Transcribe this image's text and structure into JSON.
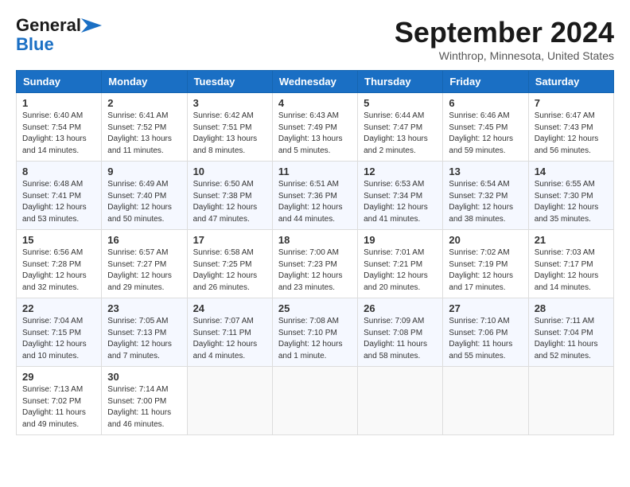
{
  "header": {
    "logo_line1": "General",
    "logo_line2": "Blue",
    "month": "September 2024",
    "location": "Winthrop, Minnesota, United States"
  },
  "days_of_week": [
    "Sunday",
    "Monday",
    "Tuesday",
    "Wednesday",
    "Thursday",
    "Friday",
    "Saturday"
  ],
  "weeks": [
    [
      {
        "day": "1",
        "info": "Sunrise: 6:40 AM\nSunset: 7:54 PM\nDaylight: 13 hours\nand 14 minutes."
      },
      {
        "day": "2",
        "info": "Sunrise: 6:41 AM\nSunset: 7:52 PM\nDaylight: 13 hours\nand 11 minutes."
      },
      {
        "day": "3",
        "info": "Sunrise: 6:42 AM\nSunset: 7:51 PM\nDaylight: 13 hours\nand 8 minutes."
      },
      {
        "day": "4",
        "info": "Sunrise: 6:43 AM\nSunset: 7:49 PM\nDaylight: 13 hours\nand 5 minutes."
      },
      {
        "day": "5",
        "info": "Sunrise: 6:44 AM\nSunset: 7:47 PM\nDaylight: 13 hours\nand 2 minutes."
      },
      {
        "day": "6",
        "info": "Sunrise: 6:46 AM\nSunset: 7:45 PM\nDaylight: 12 hours\nand 59 minutes."
      },
      {
        "day": "7",
        "info": "Sunrise: 6:47 AM\nSunset: 7:43 PM\nDaylight: 12 hours\nand 56 minutes."
      }
    ],
    [
      {
        "day": "8",
        "info": "Sunrise: 6:48 AM\nSunset: 7:41 PM\nDaylight: 12 hours\nand 53 minutes."
      },
      {
        "day": "9",
        "info": "Sunrise: 6:49 AM\nSunset: 7:40 PM\nDaylight: 12 hours\nand 50 minutes."
      },
      {
        "day": "10",
        "info": "Sunrise: 6:50 AM\nSunset: 7:38 PM\nDaylight: 12 hours\nand 47 minutes."
      },
      {
        "day": "11",
        "info": "Sunrise: 6:51 AM\nSunset: 7:36 PM\nDaylight: 12 hours\nand 44 minutes."
      },
      {
        "day": "12",
        "info": "Sunrise: 6:53 AM\nSunset: 7:34 PM\nDaylight: 12 hours\nand 41 minutes."
      },
      {
        "day": "13",
        "info": "Sunrise: 6:54 AM\nSunset: 7:32 PM\nDaylight: 12 hours\nand 38 minutes."
      },
      {
        "day": "14",
        "info": "Sunrise: 6:55 AM\nSunset: 7:30 PM\nDaylight: 12 hours\nand 35 minutes."
      }
    ],
    [
      {
        "day": "15",
        "info": "Sunrise: 6:56 AM\nSunset: 7:28 PM\nDaylight: 12 hours\nand 32 minutes."
      },
      {
        "day": "16",
        "info": "Sunrise: 6:57 AM\nSunset: 7:27 PM\nDaylight: 12 hours\nand 29 minutes."
      },
      {
        "day": "17",
        "info": "Sunrise: 6:58 AM\nSunset: 7:25 PM\nDaylight: 12 hours\nand 26 minutes."
      },
      {
        "day": "18",
        "info": "Sunrise: 7:00 AM\nSunset: 7:23 PM\nDaylight: 12 hours\nand 23 minutes."
      },
      {
        "day": "19",
        "info": "Sunrise: 7:01 AM\nSunset: 7:21 PM\nDaylight: 12 hours\nand 20 minutes."
      },
      {
        "day": "20",
        "info": "Sunrise: 7:02 AM\nSunset: 7:19 PM\nDaylight: 12 hours\nand 17 minutes."
      },
      {
        "day": "21",
        "info": "Sunrise: 7:03 AM\nSunset: 7:17 PM\nDaylight: 12 hours\nand 14 minutes."
      }
    ],
    [
      {
        "day": "22",
        "info": "Sunrise: 7:04 AM\nSunset: 7:15 PM\nDaylight: 12 hours\nand 10 minutes."
      },
      {
        "day": "23",
        "info": "Sunrise: 7:05 AM\nSunset: 7:13 PM\nDaylight: 12 hours\nand 7 minutes."
      },
      {
        "day": "24",
        "info": "Sunrise: 7:07 AM\nSunset: 7:11 PM\nDaylight: 12 hours\nand 4 minutes."
      },
      {
        "day": "25",
        "info": "Sunrise: 7:08 AM\nSunset: 7:10 PM\nDaylight: 12 hours\nand 1 minute."
      },
      {
        "day": "26",
        "info": "Sunrise: 7:09 AM\nSunset: 7:08 PM\nDaylight: 11 hours\nand 58 minutes."
      },
      {
        "day": "27",
        "info": "Sunrise: 7:10 AM\nSunset: 7:06 PM\nDaylight: 11 hours\nand 55 minutes."
      },
      {
        "day": "28",
        "info": "Sunrise: 7:11 AM\nSunset: 7:04 PM\nDaylight: 11 hours\nand 52 minutes."
      }
    ],
    [
      {
        "day": "29",
        "info": "Sunrise: 7:13 AM\nSunset: 7:02 PM\nDaylight: 11 hours\nand 49 minutes."
      },
      {
        "day": "30",
        "info": "Sunrise: 7:14 AM\nSunset: 7:00 PM\nDaylight: 11 hours\nand 46 minutes."
      },
      {
        "day": "",
        "info": ""
      },
      {
        "day": "",
        "info": ""
      },
      {
        "day": "",
        "info": ""
      },
      {
        "day": "",
        "info": ""
      },
      {
        "day": "",
        "info": ""
      }
    ]
  ]
}
